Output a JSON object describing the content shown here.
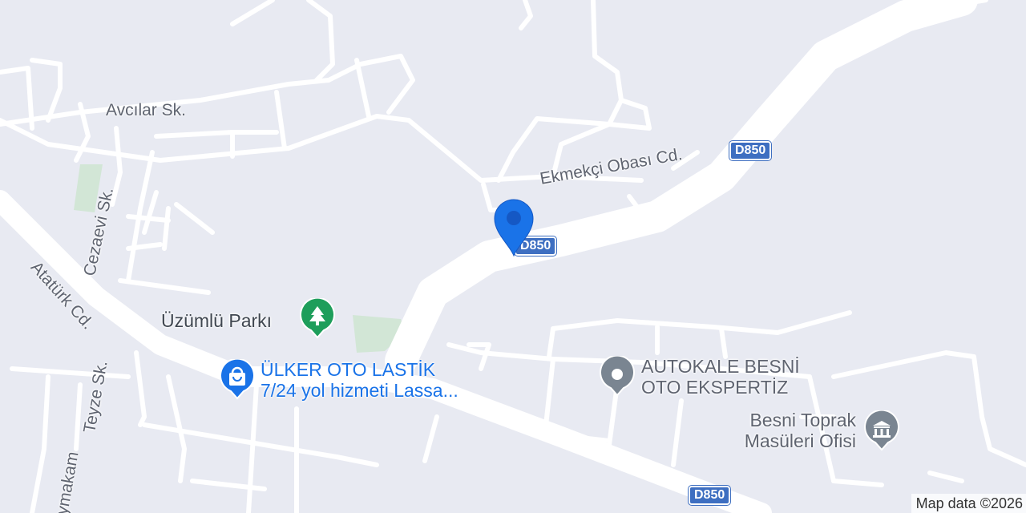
{
  "map": {
    "colors": {
      "background": "#e8eaf2",
      "road": "#ffffff",
      "park": "#d2e6d6",
      "shield": "#3e6fc1",
      "pin": "#1a73e8",
      "park_poi": "#1e9e5b",
      "shopping_poi": "#1a73e8",
      "generic_poi": "#7a8591",
      "label": "#5f6470"
    },
    "street_labels": [
      {
        "id": "avcilar",
        "text": "Avcılar Sk."
      },
      {
        "id": "ekmekci",
        "text": "Ekmekçi Obası Cd."
      },
      {
        "id": "cezaevi",
        "text": "Cezaevi Sk."
      },
      {
        "id": "ataturk",
        "text": "Atatürk Cd."
      },
      {
        "id": "teyze",
        "text": "Teyze Sk."
      },
      {
        "id": "kaymakam",
        "text": "ymakam"
      }
    ],
    "route_shields": [
      "D850",
      "D850",
      "D850"
    ],
    "pois": [
      {
        "id": "park",
        "icon": "tree-icon",
        "lines": [
          "Üzümlü Parkı"
        ],
        "color": "#1e9e5b",
        "text_color": "#3f4650"
      },
      {
        "id": "ulker",
        "icon": "shopping-bag-icon",
        "lines": [
          "ÜLKER OTO LASTİK",
          "7/24 yol hizmeti Lassa..."
        ],
        "color": "#1a73e8",
        "text_color": "#1a73e8"
      },
      {
        "id": "autokale",
        "icon": "place-icon",
        "lines": [
          "AUTOKALE BESNİ",
          "OTO EKSPERTİZ"
        ],
        "color": "#7a8591",
        "text_color": "#5f6470"
      },
      {
        "id": "toprak",
        "icon": "government-building-icon",
        "lines": [
          "Besni Toprak",
          "Masüleri Ofisi"
        ],
        "color": "#7a8591",
        "text_color": "#5f6470"
      }
    ],
    "selected_pin": {
      "icon": "location-pin-icon"
    },
    "attribution": "Map data ©2026"
  }
}
